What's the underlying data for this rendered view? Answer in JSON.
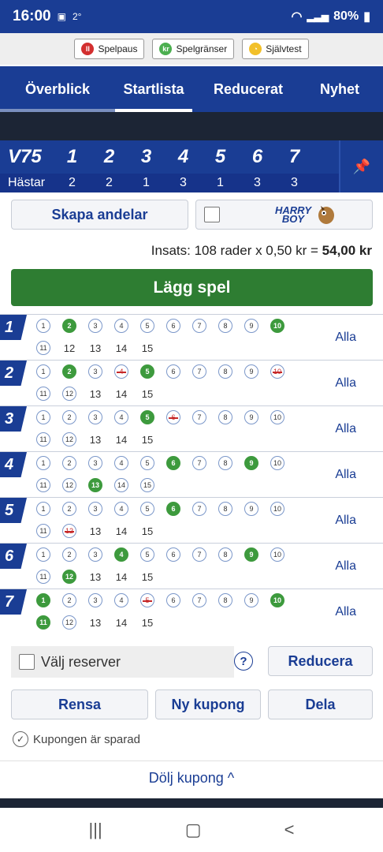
{
  "status": {
    "time": "16:00",
    "extra": "2°",
    "battery": "80%"
  },
  "respbar": [
    {
      "label": "Spelpaus",
      "color": "#d32f2f",
      "glyph": "II"
    },
    {
      "label": "Spelgränser",
      "color": "#4caf50",
      "glyph": "kr"
    },
    {
      "label": "Självtest",
      "color": "#f2c029",
      "glyph": "◔"
    }
  ],
  "tabs": [
    "Överblick",
    "Startlista",
    "Reducerat",
    "Nyhet"
  ],
  "v75": {
    "label": "V75",
    "hastar_label": "Hästar",
    "legs": [
      "1",
      "2",
      "3",
      "4",
      "5",
      "6",
      "7"
    ],
    "counts": [
      "2",
      "2",
      "1",
      "3",
      "1",
      "3",
      "3"
    ]
  },
  "buttons": {
    "skapa": "Skapa andelar",
    "harry_line1": "HARRY",
    "harry_line2": "BOY",
    "lagg": "Lägg spel",
    "reducera": "Reducera",
    "rensa": "Rensa",
    "ny_kupong": "Ny kupong",
    "dela": "Dela"
  },
  "insats": {
    "prefix": "Insats: 108 rader x 0,50 kr = ",
    "total": "54,00 kr"
  },
  "alla_label": "Alla",
  "races": [
    {
      "num": "1",
      "selected": [
        2,
        10
      ],
      "scratched": [],
      "circled2": [
        11
      ],
      "total": 15
    },
    {
      "num": "2",
      "selected": [
        2,
        5
      ],
      "scratched": [
        4,
        10
      ],
      "circled2": [
        11,
        12
      ],
      "total": 15
    },
    {
      "num": "3",
      "selected": [
        5
      ],
      "scratched": [
        6
      ],
      "circled2": [
        11,
        12
      ],
      "total": 15
    },
    {
      "num": "4",
      "selected": [
        6,
        9,
        13
      ],
      "scratched": [],
      "circled2": [
        11,
        12,
        13,
        14,
        15
      ],
      "total": 15
    },
    {
      "num": "5",
      "selected": [
        6
      ],
      "scratched": [
        12
      ],
      "circled2": [
        11,
        12
      ],
      "total": 15
    },
    {
      "num": "6",
      "selected": [
        4,
        9,
        12
      ],
      "scratched": [],
      "circled2": [
        11,
        12
      ],
      "total": 15
    },
    {
      "num": "7",
      "selected": [
        1,
        10,
        11
      ],
      "scratched": [
        5
      ],
      "circled2": [
        11,
        12
      ],
      "total": 15
    }
  ],
  "reserver_label": "Välj reserver",
  "help_glyph": "?",
  "saved_label": "Kupongen är sparad",
  "dolj_label": "Dölj kupong ^",
  "nav": [
    "|||",
    "▢",
    "<"
  ]
}
